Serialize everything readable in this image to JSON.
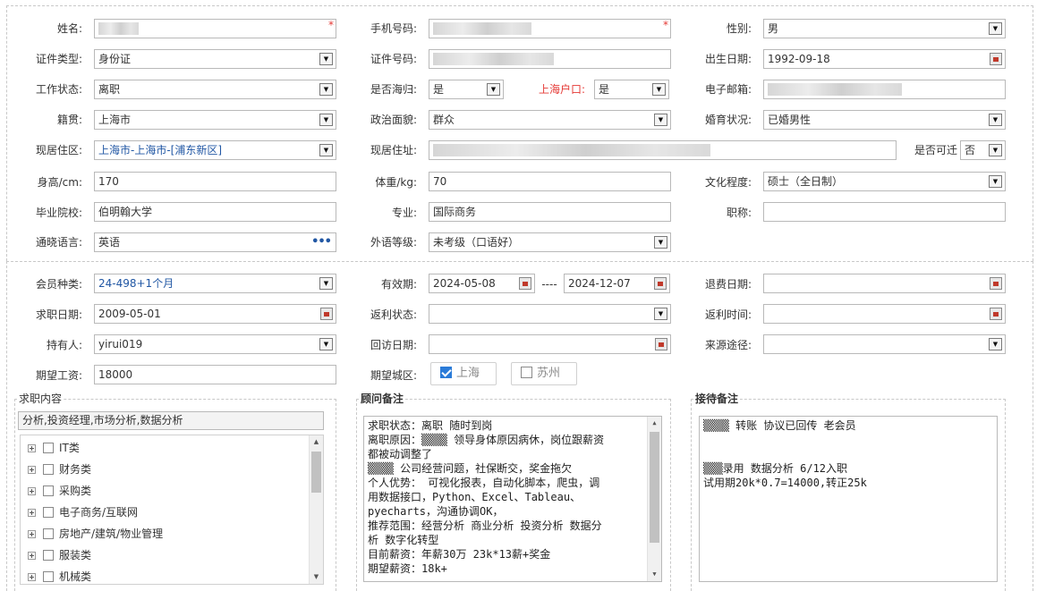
{
  "basic": {
    "name_label": "姓名:",
    "phone_label": "手机号码:",
    "gender_label": "性别:",
    "gender": "男",
    "id_type_label": "证件类型:",
    "id_type": "身份证",
    "id_no_label": "证件号码:",
    "birth_label": "出生日期:",
    "birth": "1992-09-18",
    "work_status_label": "工作状态:",
    "work_status": "离职",
    "returnee_label": "是否海归:",
    "returnee": "是",
    "hukou_label": "上海户口:",
    "hukou": "是",
    "email_label": "电子邮箱:",
    "native_label": "籍贯:",
    "native": "上海市",
    "political_label": "政治面貌:",
    "political": "群众",
    "marital_label": "婚育状况:",
    "marital": "已婚男性",
    "residence_area_label": "现居住区:",
    "residence_area": "上海市-上海市-[浦东新区]",
    "address_label": "现居住址:",
    "relocate_label": "是否可迁",
    "relocate": "否",
    "height_label": "身高/cm:",
    "height": "170",
    "weight_label": "体重/kg:",
    "weight": "70",
    "education_label": "文化程度:",
    "education": "硕士（全日制）",
    "school_label": "毕业院校:",
    "school": "伯明翰大学",
    "major_label": "专业:",
    "major": "国际商务",
    "title_label": "职称:",
    "title": "",
    "language_label": "通晓语言:",
    "language": "英语",
    "language_more": "•••",
    "foreign_level_label": "外语等级:",
    "foreign_level": "未考级（口语好）"
  },
  "membership": {
    "member_type_label": "会员种类:",
    "member_type": "24-498+1个月",
    "valid_label": "有效期:",
    "valid_from": "2024-05-08",
    "valid_sep": "----",
    "valid_to": "2024-12-07",
    "refund_date_label": "退费日期:",
    "refund_date": "",
    "job_date_label": "求职日期:",
    "job_date": "2009-05-01",
    "rebate_status_label": "返利状态:",
    "rebate_status": "",
    "rebate_time_label": "返利时间:",
    "rebate_time": "",
    "holder_label": "持有人:",
    "holder": "yirui019",
    "visit_date_label": "回访日期:",
    "visit_date": "",
    "source_label": "来源途径:",
    "source": "",
    "salary_label": "期望工资:",
    "salary": "18000",
    "city_label": "期望城区:",
    "cities": [
      {
        "label": "上海",
        "checked": true
      },
      {
        "label": "苏州",
        "checked": false
      }
    ]
  },
  "job_content": {
    "legend": "求职内容",
    "summary": "分析,投资经理,市场分析,数据分析",
    "categories": [
      "IT类",
      "财务类",
      "采购类",
      "电子商务/互联网",
      "房地产/建筑/物业管理",
      "服装类",
      "机械类"
    ]
  },
  "consultant_notes": {
    "legend": "顾问备注",
    "lines": [
      "求职状态：离职 随时到岗",
      "离职原因：▒▒▒▒ 领导身体原因病休，岗位跟薪资",
      "都被动调整了",
      "▒▒▒▒ 公司经营问题，社保断交，奖金拖欠",
      "个人优势： 可视化报表，自动化脚本，爬虫，调",
      "用数据接口，Python、Excel、Tableau、",
      "pyecharts，沟通协调OK，",
      "推荐范围：经营分析 商业分析 投资分析 数据分",
      "析 数字化转型",
      "目前薪资：年薪30万  23k*13薪+奖金",
      "期望薪资：18k+"
    ]
  },
  "reception_notes": {
    "legend": "接待备注",
    "lines": [
      "▒▒▒▒  转账  协议已回传   老会员",
      "",
      "",
      "▒▒▒录用 数据分析   6/12入职",
      "试用期20k*0.7=14000,转正25k"
    ]
  }
}
